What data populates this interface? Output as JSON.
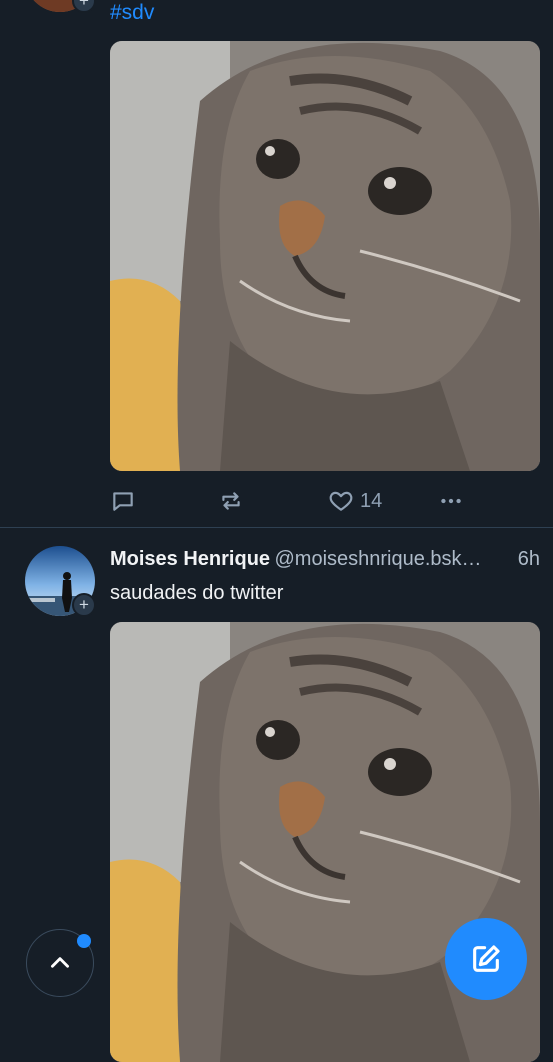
{
  "feed": {
    "posts": [
      {
        "hashtag": "#sdv",
        "like_count": "14"
      },
      {
        "display_name": "Moises Henrique",
        "handle": "@moiseshnrique.bsk…",
        "time": "6h",
        "text": "saudades do twitter"
      }
    ]
  },
  "colors": {
    "background": "#161e27",
    "accent": "#208bfe",
    "muted_text": "#aebbc9",
    "divider": "#2e4052"
  },
  "icons": {
    "reply": "reply-icon",
    "repost": "repost-icon",
    "like": "heart-icon",
    "more": "more-icon",
    "scroll_top": "chevron-up-icon",
    "compose": "compose-icon"
  }
}
